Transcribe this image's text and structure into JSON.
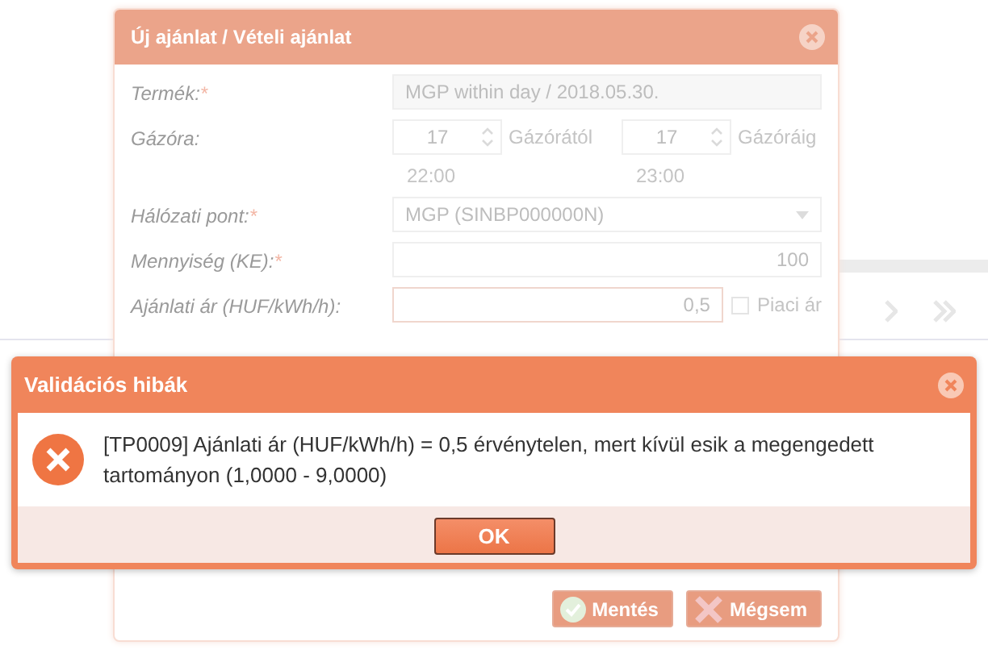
{
  "offer_dialog": {
    "title": "Új ajánlat / Vételi ajánlat",
    "fields": [
      {
        "kind": "readonly",
        "label": "Termék:",
        "required_mark": "*",
        "value": "MGP within day / 2018.05.30."
      },
      {
        "kind": "hours",
        "label": "Gázóra:",
        "from_value": "17",
        "from_label": "Gázórától",
        "from_time": "22:00",
        "to_value": "17",
        "to_label": "Gázóráig",
        "to_time": "23:00"
      },
      {
        "kind": "select",
        "label": "Hálózati pont:",
        "required_mark": "*",
        "value": "MGP (SINBP000000N)"
      },
      {
        "kind": "number",
        "label": "Mennyiség (KE):",
        "required_mark": "*",
        "value": "100"
      },
      {
        "kind": "price",
        "label": "Ajánlati ár (HUF/kWh/h):",
        "value": "0,5",
        "checkbox_label": "Piaci ár",
        "checked": false
      }
    ],
    "buttons": [
      {
        "kind": "save",
        "label": "Mentés"
      },
      {
        "kind": "cancel",
        "label": "Mégsem"
      }
    ]
  },
  "alert": {
    "title": "Validációs hibák",
    "message": "[TP0009] Ajánlati ár (HUF/kWh/h) = 0,5 érvénytelen, mert kívül esik a megengedett tartományon (1,0000 - 9,0000)",
    "button": "OK"
  }
}
